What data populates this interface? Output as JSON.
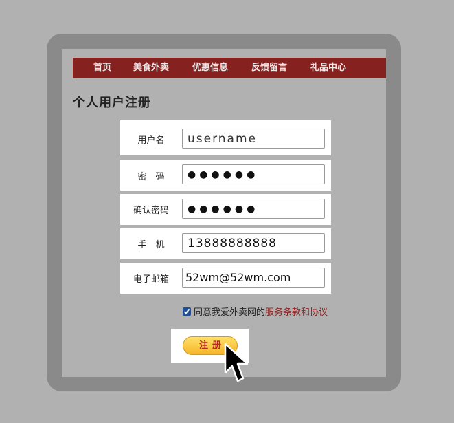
{
  "nav": {
    "items": [
      "首页",
      "美食外卖",
      "优惠信息",
      "反馈留言",
      "礼品中心"
    ]
  },
  "page": {
    "title": "个人用户注册"
  },
  "form": {
    "username": {
      "label": "用户名",
      "value": "username"
    },
    "password": {
      "label": "密　码",
      "value": "●●●●●●"
    },
    "confirm_password": {
      "label": "确认密码",
      "value": "●●●●●●"
    },
    "phone": {
      "label": "手　机",
      "value": "13888888888"
    },
    "email": {
      "label": "电子邮箱",
      "value": "52wm@52wm.com"
    }
  },
  "agree": {
    "checked": true,
    "text": "同意我爱外卖网的",
    "link": "服务条款和协议"
  },
  "submit": {
    "label": "注册"
  },
  "colors": {
    "nav_bg": "#85211f",
    "link": "#8a2424",
    "button_gradient_top": "#ffe06a",
    "button_gradient_bottom": "#f5b528"
  },
  "icons": {
    "cursor": "arrow-cursor-icon",
    "checkbox": "checked-checkbox-icon"
  }
}
